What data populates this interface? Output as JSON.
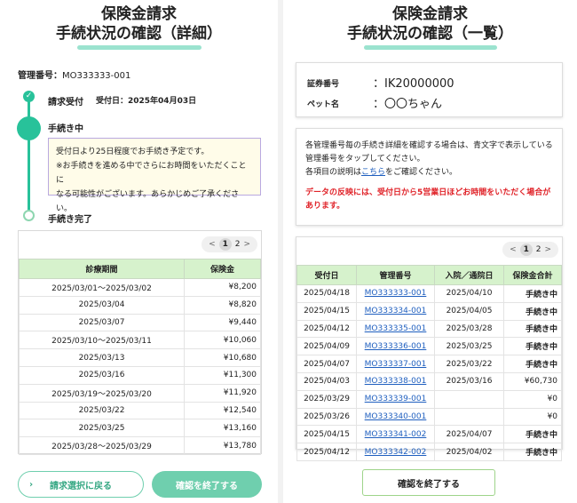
{
  "detail": {
    "title_l1": "保険金請求",
    "title_l2": "手続状況の確認（詳細）",
    "mgmt_label": "管理番号：",
    "mgmt_value": "MO333333-001",
    "steps": [
      {
        "label": "請求受付",
        "date": "受付日：2025年04月03日"
      },
      {
        "label": "手続き中"
      },
      {
        "label": "手続き完了"
      }
    ],
    "check_mark": "✓",
    "notice_l1": "受付日より25日程度でお手続き予定です。",
    "notice_l2": "※お手続きを進める中でさらにお時間をいただくことに",
    "notice_l3": "なる可能性がございます。あらかじめご了承ください。",
    "pager": {
      "prev": "<",
      "p1": "1",
      "p2": "2",
      "next": ">"
    },
    "headers": [
      "診療期間",
      "保険金"
    ],
    "rows": [
      [
        "2025/03/01〜2025/03/02",
        "¥8,200"
      ],
      [
        "2025/03/04",
        "¥8,820"
      ],
      [
        "2025/03/07",
        "¥9,440"
      ],
      [
        "2025/03/10〜2025/03/11",
        "¥10,060"
      ],
      [
        "2025/03/13",
        "¥10,680"
      ],
      [
        "2025/03/16",
        "¥11,300"
      ],
      [
        "2025/03/19〜2025/03/20",
        "¥11,920"
      ],
      [
        "2025/03/22",
        "¥12,540"
      ],
      [
        "2025/03/25",
        "¥13,160"
      ],
      [
        "2025/03/28〜2025/03/29",
        "¥13,780"
      ]
    ],
    "back_arrow": "›",
    "back_label": "請求選択に戻る",
    "finish_label": "確認を終了する"
  },
  "list": {
    "title_l1": "保険金請求",
    "title_l2": "手続状況の確認（一覧）",
    "policy_label": "証券番号",
    "policy_value": "：IK20000000",
    "pet_label": "ペット名",
    "pet_value": "：〇〇ちゃん",
    "desc_l1": "各管理番号毎の手続き詳細を確認する場合は、青文字で表示している",
    "desc_l2": "管理番号をタップしてください。",
    "desc_l3a": "各項目の説明は",
    "desc_link": "こちら",
    "desc_l3b": "をご確認ください。",
    "warn_l1": "データの反映には、受付日から5営業日ほどお時間をいただく場合が",
    "warn_l2": "あります。",
    "pager": {
      "prev": "<",
      "p1": "1",
      "p2": "2",
      "next": ">"
    },
    "headers": [
      "受付日",
      "管理番号",
      "入院／通院日",
      "保険金合計"
    ],
    "rows": [
      [
        "2025/04/18",
        "MO333333-001",
        "2025/04/10",
        "手続き中"
      ],
      [
        "2025/04/15",
        "MO333334-001",
        "2025/04/05",
        "手続き中"
      ],
      [
        "2025/04/12",
        "MO333335-001",
        "2025/03/28",
        "手続き中"
      ],
      [
        "2025/04/09",
        "MO333336-001",
        "2025/03/25",
        "手続き中"
      ],
      [
        "2025/04/07",
        "MO333337-001",
        "2025/03/22",
        "手続き中"
      ],
      [
        "2025/04/03",
        "MO333338-001",
        "2025/03/16",
        "¥60,730"
      ],
      [
        "2025/03/29",
        "MO333339-001",
        "",
        "¥0"
      ],
      [
        "2025/03/26",
        "MO333340-001",
        "",
        "¥0"
      ],
      [
        "2025/04/15",
        "MO333341-002",
        "2025/04/07",
        "手続き中"
      ],
      [
        "2025/04/12",
        "MO333342-002",
        "2025/04/02",
        "手続き中"
      ]
    ],
    "finish_label": "確認を終了する"
  }
}
